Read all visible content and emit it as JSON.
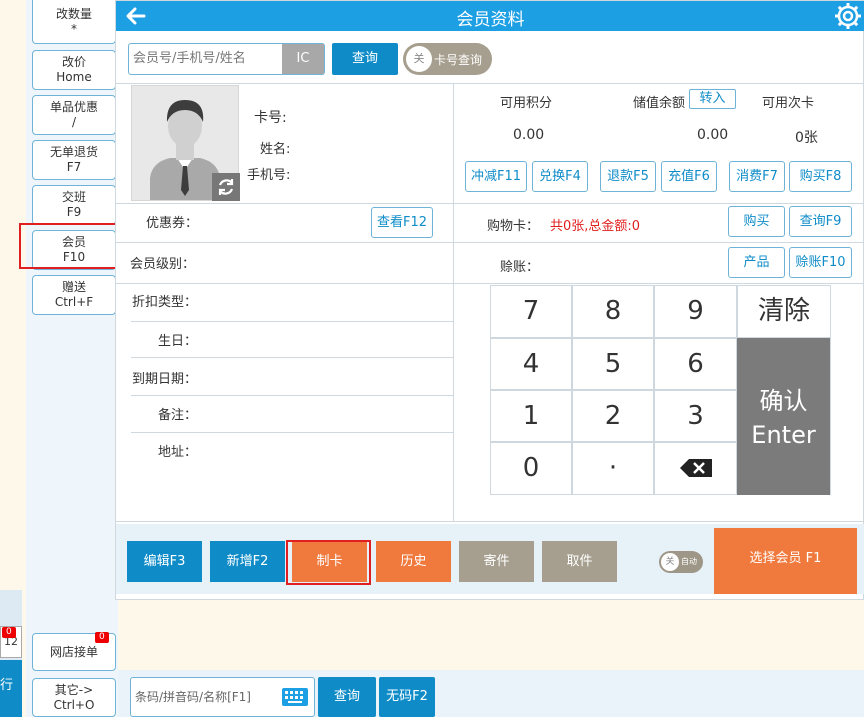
{
  "sidebar": {
    "items": [
      {
        "line1": "改数量",
        "line2": "*"
      },
      {
        "line1": "改价",
        "line2": "Home"
      },
      {
        "line1": "单品优惠",
        "line2": "/"
      },
      {
        "line1": "无单退货",
        "line2": "F7"
      },
      {
        "line1": "交班",
        "line2": "F9"
      },
      {
        "line1": "会员",
        "line2": "F10"
      },
      {
        "line1": "赠送",
        "line2": "Ctrl+F"
      }
    ],
    "online_orders": {
      "label": "网店接单",
      "badge": "0"
    },
    "other": {
      "line1": "其它->",
      "line2": "Ctrl+O"
    },
    "left_badge": "0",
    "left_badge_text": "12",
    "left_blue_text": "行"
  },
  "dialog": {
    "title": "会员资料",
    "search": {
      "placeholder": "会员号/手机号/姓名",
      "ic_label": "IC",
      "query_label": "查询"
    },
    "card_toggle": {
      "knob": "关",
      "label": "卡号查询"
    },
    "fields": {
      "card_no": "卡号:",
      "name": "姓名:",
      "phone": "手机号:",
      "coupon": "优惠券：",
      "view_coupon": "查看F12",
      "level": "会员级别：",
      "discount": "折扣类型：",
      "birthday": "生日：",
      "expiry": "到期日期：",
      "remark": "备注：",
      "address": "地址："
    },
    "stats": {
      "points_label": "可用积分",
      "points_value": "0.00",
      "balance_label": "储值余额",
      "transfer_in": "转入",
      "balance_value": "0.00",
      "times_label": "可用次卡",
      "times_value": "0张"
    },
    "op_buttons": [
      "冲减F11",
      "兑换F4",
      "退款F5",
      "充值F6",
      "消费F7",
      "购买F8"
    ],
    "shopping_card": {
      "label": "购物卡：",
      "value": "共0张,总金额:0",
      "buy": "购买",
      "query": "查询F9"
    },
    "credit": {
      "label": "赊账：",
      "product": "产品",
      "credit_btn": "赊账F10"
    },
    "keypad": {
      "keys": [
        "7",
        "8",
        "9",
        "清除",
        "4",
        "5",
        "6",
        "1",
        "2",
        "3",
        "0",
        "·"
      ],
      "enter_line1": "确认",
      "enter_line2": "Enter"
    },
    "bottom": {
      "edit": "编辑F3",
      "add": "新增F2",
      "make_card": "制卡",
      "history": "历史",
      "deposit": "寄件",
      "pickup": "取件",
      "auto_knob": "关",
      "auto_label": "自动",
      "select_member": "选择会员 F1"
    }
  },
  "bottom_search": {
    "placeholder": "条码/拼音码/名称[F1]",
    "query": "查询",
    "no_code": "无码F2"
  },
  "colors": {
    "primary": "#1d9fe3",
    "button_blue": "#0f8cc8",
    "orange": "#f07a3e",
    "gray_btn": "#a69f8f",
    "highlight": "#e02020"
  }
}
